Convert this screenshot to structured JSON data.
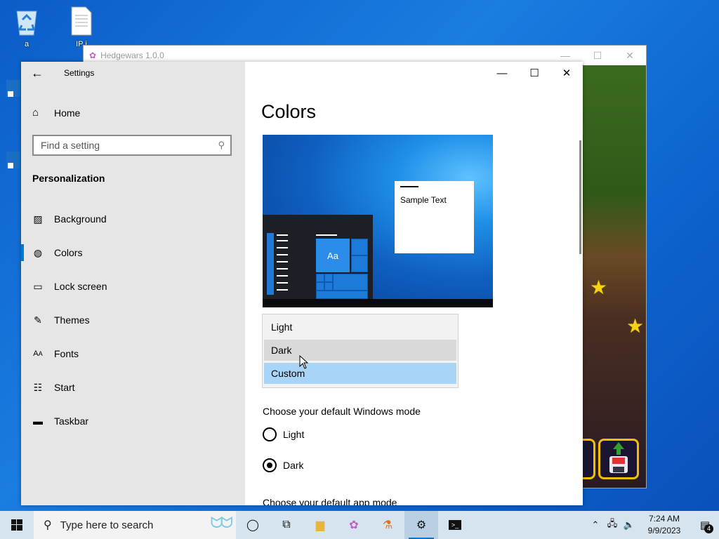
{
  "desktop": {
    "icons": [
      {
        "label": "a"
      },
      {
        "label": "IP i"
      }
    ]
  },
  "background_window": {
    "title": "Hedgewars 1.0.0"
  },
  "settings": {
    "app_title": "Settings",
    "home_label": "Home",
    "search_placeholder": "Find a setting",
    "section_heading": "Personalization",
    "nav_items": [
      {
        "label": "Background",
        "icon": "picture-icon"
      },
      {
        "label": "Colors",
        "icon": "palette-icon",
        "active": true
      },
      {
        "label": "Lock screen",
        "icon": "lock-screen-icon"
      },
      {
        "label": "Themes",
        "icon": "brush-icon"
      },
      {
        "label": "Fonts",
        "icon": "font-icon"
      },
      {
        "label": "Start",
        "icon": "start-menu-icon"
      },
      {
        "label": "Taskbar",
        "icon": "taskbar-icon"
      }
    ],
    "page_title": "Colors",
    "preview": {
      "sample_text": "Sample Text",
      "tile_label": "Aa"
    },
    "color_dropdown": {
      "options": [
        "Light",
        "Dark",
        "Custom"
      ],
      "hovered": "Dark",
      "selected": "Custom"
    },
    "windows_mode": {
      "heading": "Choose your default Windows mode",
      "options": [
        "Light",
        "Dark"
      ],
      "selected": "Dark"
    },
    "app_mode_heading": "Choose your default app mode",
    "accent_color": "#0078d7"
  },
  "taskbar": {
    "search_placeholder": "Type here to search",
    "time": "7:24 AM",
    "date": "9/9/2023",
    "notification_count": "4"
  }
}
